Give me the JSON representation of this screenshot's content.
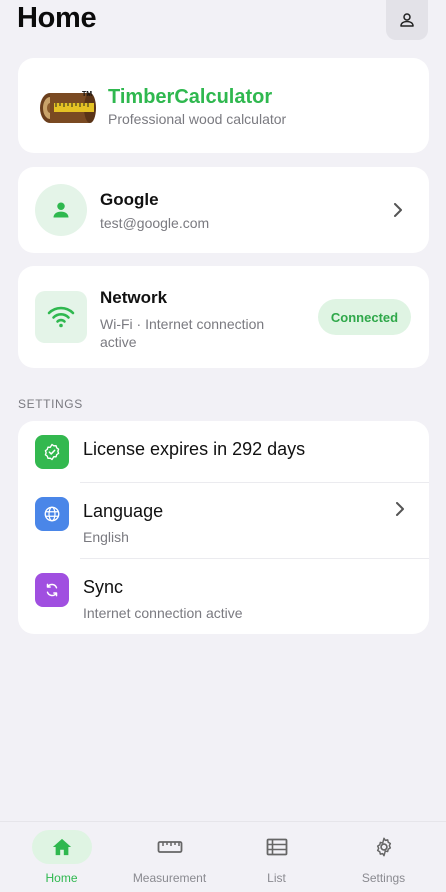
{
  "header": {
    "title": "Home"
  },
  "app": {
    "name": "TimberCalculator",
    "subtitle": "Professional wood calculator"
  },
  "account": {
    "name": "Google",
    "email": "test@google.com"
  },
  "network": {
    "title": "Network",
    "status_text": "Wi-Fi · Internet connection active",
    "badge": "Connected"
  },
  "settings": {
    "section_label": "SETTINGS",
    "license": {
      "title": "License expires in 292 days"
    },
    "language": {
      "title": "Language",
      "value": "English"
    },
    "sync": {
      "title": "Sync",
      "status": "Internet connection active"
    }
  },
  "nav": {
    "items": [
      {
        "label": "Home",
        "icon": "home-icon",
        "active": true
      },
      {
        "label": "Measurement",
        "icon": "ruler-icon",
        "active": false
      },
      {
        "label": "List",
        "icon": "list-icon",
        "active": false
      },
      {
        "label": "Settings",
        "icon": "gear-icon",
        "active": false
      }
    ]
  },
  "colors": {
    "accent": "#2fb84f",
    "license_icon_bg": "#33b84f",
    "language_icon_bg": "#4a86e8",
    "sync_icon_bg": "#a04fe0",
    "background": "#f2f1f6"
  }
}
